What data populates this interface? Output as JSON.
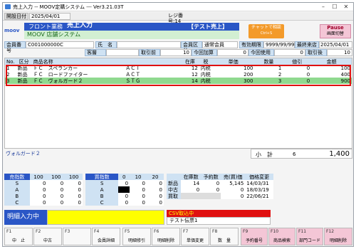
{
  "window": {
    "title": "売上入力 -- MOOV定購システム --- Ver3.21.03T",
    "minimize": "–",
    "maximize": "☐",
    "close": "✕"
  },
  "infobar": {
    "open_date_label": "開設日付",
    "open_date": "2025/04/01",
    "register_label": "レジ番号:14"
  },
  "header": {
    "logo": "moov",
    "section": "フロント業務",
    "screen_title": "売上入力",
    "mode": "【テスト売上】",
    "chat_button": "チャットで相談",
    "chat_shortcut": "Ctrl+S",
    "pause_button": "Pause",
    "pause_sub": "画面切替",
    "store_name": "MOOV 店舗システム"
  },
  "customer": {
    "no_label": "会員番号",
    "no_value": "C001000000C",
    "name_label": "氏　名",
    "name_value": "",
    "type_label": "会員区分",
    "type_value": "通常会員",
    "expiry_label": "有効期限",
    "expiry_value": "9999/99/99",
    "last_visit_label": "最終来店",
    "last_visit_value": "2025/04/01",
    "guest_label": "客層",
    "guest_value": "",
    "txn_count_label": "取引前",
    "txn_count_value": "10",
    "points_add_label": "今回加算",
    "points_add_value": "0",
    "points_use_label": "今回使用",
    "points_use_value": "0",
    "after_label": "取引後",
    "after_value": "10"
  },
  "items_table": {
    "columns": [
      "No.",
      "区分",
      "商品名称",
      "",
      "在庫",
      "税",
      "単価",
      "数量",
      "値引",
      "金額"
    ],
    "rows": [
      {
        "no": "1",
        "kubun": "新品",
        "cat": "ＦＣ",
        "name": "スペランカー",
        "maker": "ＡＣＴ",
        "stock": "12",
        "tax": "内税",
        "price": "100",
        "qty": "1",
        "disc": "0",
        "amount": "100"
      },
      {
        "no": "2",
        "kubun": "新品",
        "cat": "ＦＣ",
        "name": "ロードファイター",
        "maker": "ＡＣＴ",
        "stock": "12",
        "tax": "内税",
        "price": "200",
        "qty": "2",
        "disc": "0",
        "amount": "400"
      },
      {
        "no": "3",
        "kubun": "新品",
        "cat": "ＦＣ",
        "name": "ヴォルガード２",
        "maker": "ＳＴＧ",
        "stock": "14",
        "tax": "内税",
        "price": "300",
        "qty": "3",
        "disc": "0",
        "amount": "900"
      }
    ]
  },
  "selected_item_name": "ヴォルガード２",
  "subtotal": {
    "label": "小　計",
    "qty": "6",
    "amount": "1,400"
  },
  "sell_count": {
    "header": [
      "売指数",
      "100",
      "100",
      "100"
    ],
    "rows": [
      {
        "label": "S",
        "v": [
          "0",
          "0",
          "0"
        ]
      },
      {
        "label": "A",
        "v": [
          "0",
          "0",
          "0"
        ]
      },
      {
        "label": "B",
        "v": [
          "0",
          "0",
          "0"
        ]
      },
      {
        "label": "C",
        "v": [
          "0",
          "0",
          "0"
        ]
      }
    ]
  },
  "buy_count": {
    "header": [
      "買指数",
      "0",
      "10",
      "20"
    ],
    "rows": [
      {
        "label": "S",
        "v": [
          "0",
          "0",
          "0"
        ]
      },
      {
        "label": "A",
        "v": [
          "",
          "0",
          "0"
        ]
      },
      {
        "label": "B",
        "v": [
          "0",
          "0",
          "0"
        ]
      },
      {
        "label": "C",
        "v": [
          "0",
          "0",
          "0"
        ]
      }
    ]
  },
  "stock_info": {
    "header": [
      "",
      "在庫数",
      "予約数",
      "売(買)価",
      "価格変更"
    ],
    "rows": [
      {
        "label": "新品",
        "stock": "14",
        "reserve": "0",
        "price": "5,145",
        "date": "14/03/31"
      },
      {
        "label": "中古",
        "stock": "0",
        "reserve": "0",
        "price": "0",
        "date": "18/03/19"
      },
      {
        "label": "買取",
        "stock": "",
        "reserve": "",
        "price": "0",
        "date": "22/06/21"
      }
    ]
  },
  "detail_input_label": "明細入力中",
  "csv_label": "CSV取込中",
  "slip_label": "テスト伝票1",
  "fkeys": [
    {
      "n": "F1",
      "l": "中　止"
    },
    {
      "n": "F2",
      "l": "中古"
    },
    {
      "n": "F3",
      "l": ""
    },
    {
      "n": "F4",
      "l": "会員詳細"
    },
    {
      "n": "F5",
      "l": "明細修引"
    },
    {
      "n": "F6",
      "l": "明細削除"
    },
    {
      "n": "F7",
      "l": "単価変更"
    },
    {
      "n": "F8",
      "l": "数　量"
    },
    {
      "n": "F9",
      "l": "予約番号"
    },
    {
      "n": "F10",
      "l": "商品検索"
    },
    {
      "n": "F11",
      "l": "部門コード"
    },
    {
      "n": "F12",
      "l": "明細削除"
    }
  ],
  "colors": {
    "brand_blue": "#2a56c6",
    "highlight_red": "#e01010",
    "row_selected": "#8fd98f",
    "fkey_pink": "#f4c6d6"
  }
}
